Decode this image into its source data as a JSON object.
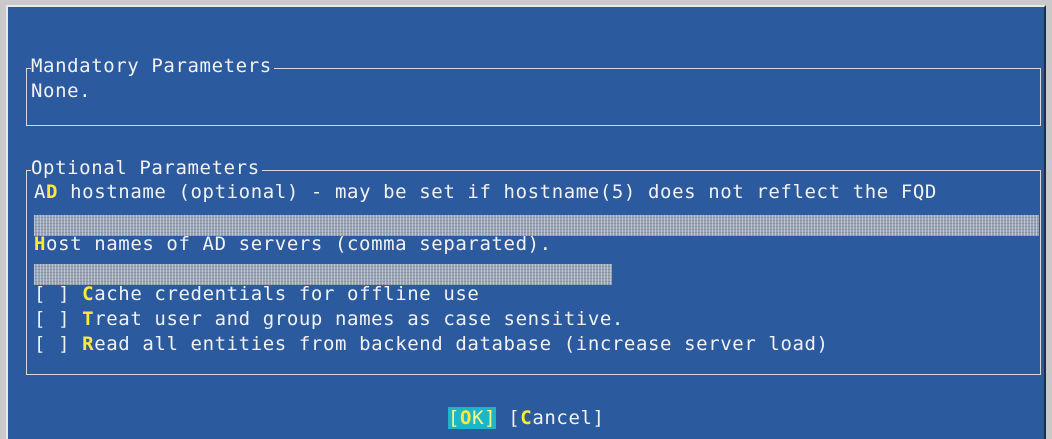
{
  "mandatory": {
    "title": "Mandatory Parameters",
    "text": "None."
  },
  "optional": {
    "title": "Optional Parameters",
    "ad_hostname": {
      "hot": "D",
      "pre": "A",
      "post": " hostname (optional) - may be set if hostname(5) does not reflect the FQD",
      "value": ""
    },
    "ad_servers": {
      "hot": "H",
      "pre": "",
      "post": "ost names of AD servers (comma separated).",
      "value": ""
    },
    "checkboxes": [
      {
        "box": "[ ]",
        "hot": "C",
        "post": "ache credentials for offline use"
      },
      {
        "box": "[ ]",
        "hot": "T",
        "post": "reat user and group names as case sensitive."
      },
      {
        "box": "[ ]",
        "hot": "R",
        "post": "ead all entities from backend database (increase server load)"
      }
    ]
  },
  "buttons": {
    "ok": {
      "open": "[",
      "hot": "O",
      "rest": "K",
      "close": "]"
    },
    "cancel": {
      "open": "[",
      "hot": "C",
      "rest": "ancel",
      "close": "]"
    }
  },
  "colors": {
    "dialog_bg": "#2c5a9e",
    "hotkey": "#ffe83a",
    "focus": "#1db6c8"
  }
}
